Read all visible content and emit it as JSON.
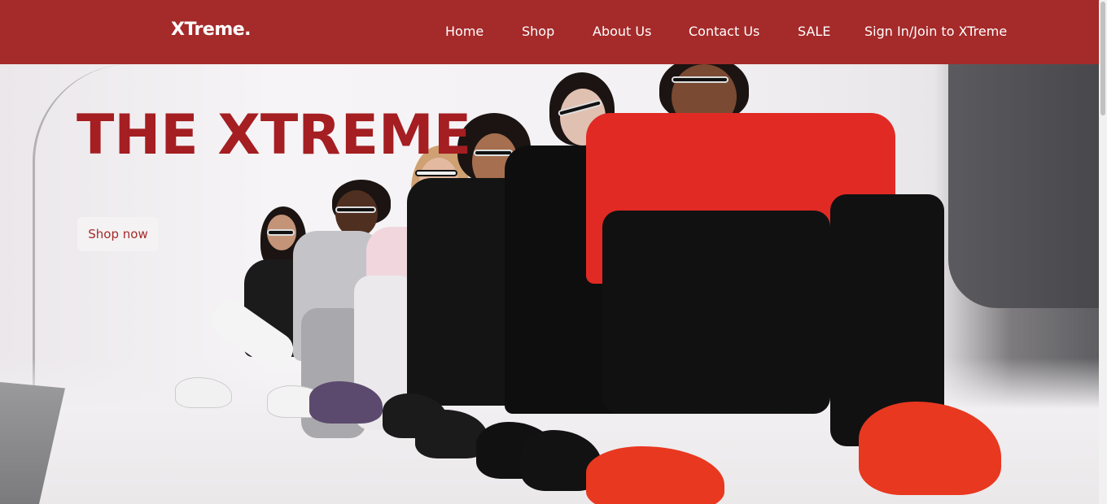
{
  "header": {
    "logo": "XTreme.",
    "nav": [
      {
        "label": "Home"
      },
      {
        "label": "Shop"
      },
      {
        "label": "About Us"
      },
      {
        "label": "Contact Us"
      },
      {
        "label": "SALE"
      },
      {
        "label": "Sign In/Join to XTreme"
      }
    ]
  },
  "hero": {
    "title": "THE XTREME",
    "cta_label": "Shop now",
    "image_subject": "group of people in streetwear sitting on studio floor"
  },
  "colors": {
    "brand": "#a52a2a",
    "title": "#a41e22",
    "nav_text": "#ffffff",
    "button_bg": "#f4f2f3"
  }
}
